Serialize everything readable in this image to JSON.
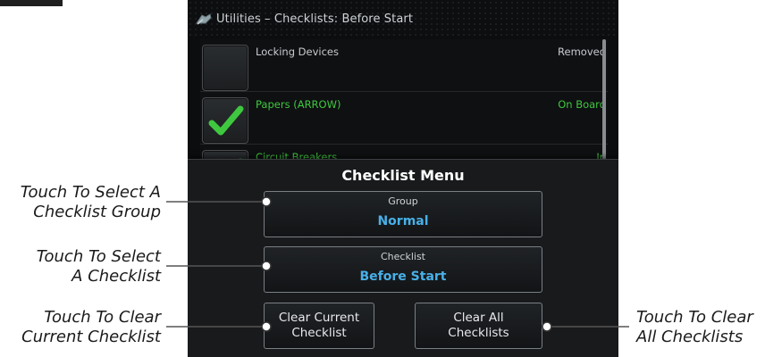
{
  "screen": {
    "title": "Utilities – Checklists: Before Start",
    "checklist_items": [
      {
        "item": "Locking Devices",
        "value": "Removed",
        "checked": false
      },
      {
        "item": "Papers (ARROW)",
        "value": "On Board",
        "checked": true
      },
      {
        "item": "Circuit Breakers",
        "value": "In",
        "checked": true
      }
    ]
  },
  "menu": {
    "title": "Checklist Menu",
    "group_label": "Group",
    "group_value": "Normal",
    "checklist_label": "Checklist",
    "checklist_value": "Before Start",
    "clear_current": "Clear Current\nChecklist",
    "clear_all": "Clear All\nChecklists"
  },
  "callouts": {
    "select_group": "Touch To Select A\nChecklist Group",
    "select_checklist": "Touch To Select\nA Checklist",
    "clear_current": "Touch To Clear\nCurrent Checklist",
    "clear_all": "Touch To Clear\nAll Checklists"
  },
  "colors": {
    "checked_text": "#3fc83f",
    "value_blue": "#48b0e8",
    "panel_bg": "#181a1c"
  }
}
